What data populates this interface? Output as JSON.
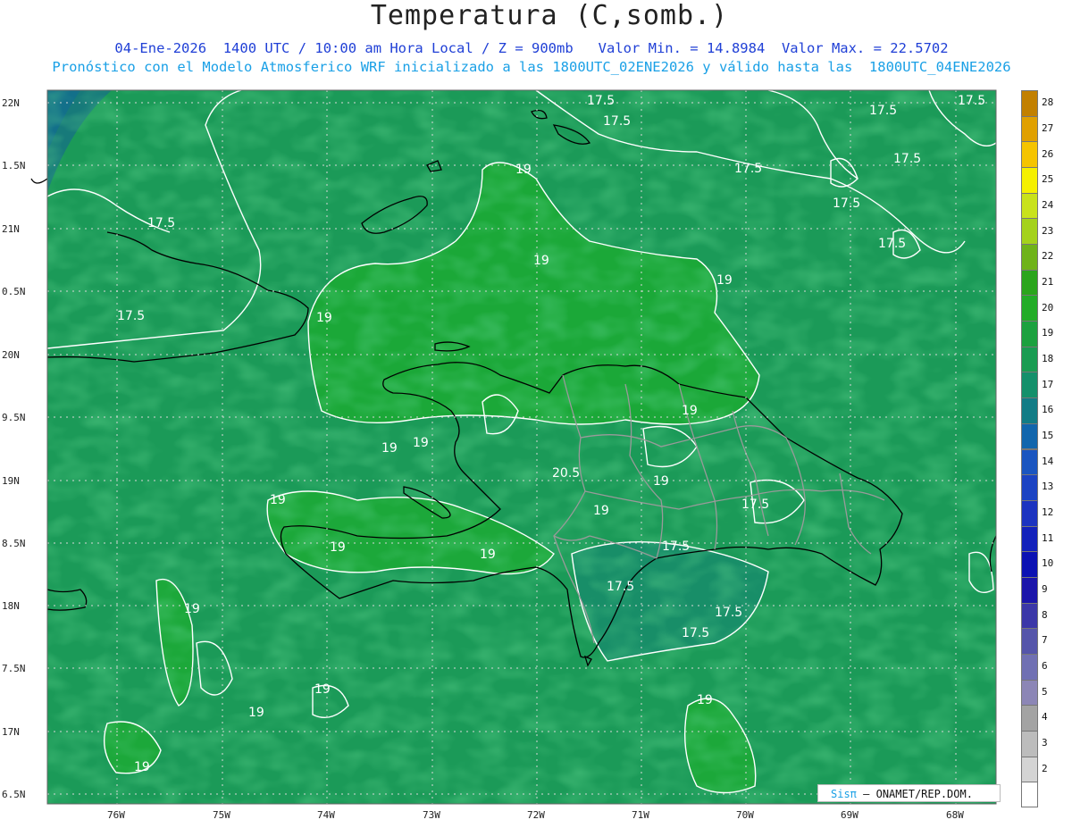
{
  "title": "Temperatura (C,somb.)",
  "subtitle_line1": "04-Ene-2026  1400 UTC / 10:00 am Hora Local / Z = 900mb   Valor Min. = 14.8984  Valor Max. = 22.5702",
  "subtitle_line2": "Pronóstico con el Modelo Atmosferico WRF inicializado a las 1800UTC_02ENE2026 y válido hasta las  1800UTC_04ENE2026",
  "latitude_labels": [
    "22N",
    "1.5N",
    "21N",
    "0.5N",
    "20N",
    "9.5N",
    "19N",
    "8.5N",
    "18N",
    "7.5N",
    "17N",
    "6.5N"
  ],
  "longitude_labels": [
    "76W",
    "75W",
    "74W",
    "73W",
    "72W",
    "71W",
    "70W",
    "69W",
    "68W"
  ],
  "contour_labels": [
    "17.5",
    "17.5",
    "17.5",
    "17.5",
    "17.5",
    "17.5",
    "17.5",
    "17.5",
    "17.5",
    "17.5",
    "17.5",
    "17.5",
    "19",
    "19",
    "19",
    "19",
    "19",
    "19",
    "19",
    "19",
    "19",
    "19",
    "19",
    "19",
    "19",
    "19",
    "19",
    "20.5"
  ],
  "colorbar": {
    "values": [
      "28",
      "27",
      "26",
      "25",
      "24",
      "23",
      "22",
      "21",
      "20",
      "19",
      "18",
      "17",
      "16",
      "15",
      "14",
      "13",
      "12",
      "11",
      "10",
      "9",
      "8",
      "7",
      "6",
      "5",
      "4",
      "3",
      "2"
    ],
    "colors": [
      "#c28000",
      "#e0a000",
      "#f5c400",
      "#f5f000",
      "#c9e21b",
      "#a4d21b",
      "#6fb319",
      "#2aa51c",
      "#22ac27",
      "#1ca13f",
      "#199c52",
      "#14906b",
      "#127c86",
      "#1266ad",
      "#1a55c0",
      "#1b43c3",
      "#1c33c0",
      "#1321bb",
      "#0c12b3",
      "#1b15aa",
      "#3b37a8",
      "#5555aa",
      "#7070b3",
      "#8c86b6",
      "#a3a3a3",
      "#bcbcbc",
      "#d4d4d4"
    ]
  },
  "credit": {
    "brand": "Sisπ",
    "text": "– ONAMET/REP.DOM."
  }
}
